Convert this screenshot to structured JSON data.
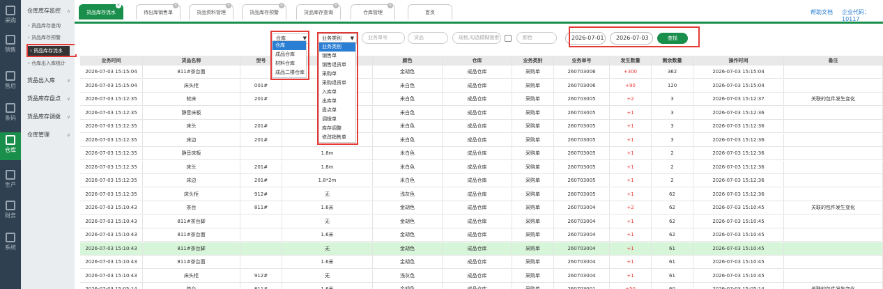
{
  "rail": [
    {
      "label": "采购",
      "icon": "cart-icon"
    },
    {
      "label": "销售",
      "icon": "grid-icon"
    },
    {
      "label": "售后",
      "icon": "building-icon"
    },
    {
      "label": "条码",
      "icon": "barcode-icon"
    },
    {
      "label": "仓库",
      "icon": "warehouse-icon"
    },
    {
      "label": "生产",
      "icon": "robot-arm-icon"
    },
    {
      "label": "财务",
      "icon": "calculator-icon"
    },
    {
      "label": "系统",
      "icon": "gear-icon"
    }
  ],
  "menu": {
    "group1": "仓库库存监控",
    "subs": [
      "› 货品库存查询",
      "› 货品库存预警",
      "› 货品库存流水",
      "› 仓库出入库统计"
    ],
    "group2": "货品出入库",
    "group3": "货品库存盘点",
    "group4": "货品库存调拨",
    "group5": "仓库管理"
  },
  "tabs": [
    "货品库存流水",
    "待出库销售单",
    "货品资料管理",
    "货品库存预警",
    "货品库存查询",
    "仓库管理",
    "首页"
  ],
  "top_links": {
    "help": "帮助文档",
    "company": "企业代码：10117"
  },
  "filters": {
    "warehouse_label": "仓库",
    "type_label": "业务类别",
    "order_no": "业务单号",
    "goods": "货品",
    "spec": "规格,勾选模糊搜索",
    "color": "颜色",
    "date_from": "2026-07-01",
    "date_to": "2026-07-03",
    "search_btn": "查找"
  },
  "warehouse_options": [
    "仓库",
    "成品仓库",
    "材料仓库",
    "成品二楼仓库"
  ],
  "type_options": [
    "业务类别",
    "销售单",
    "销售退货单",
    "采购单",
    "采购退货单",
    "入库单",
    "出库单",
    "盘点单",
    "调拨单",
    "库存调整",
    "修改销售单"
  ],
  "columns": [
    "业务时间",
    "货品名称",
    "型号",
    "规格",
    "颜色",
    "仓库",
    "业务类别",
    "业务单号",
    "发生数量",
    "剩余数量",
    "操作时间",
    "备注"
  ],
  "rows": [
    [
      "2026-07-03 15:15:04",
      "811#茶台面",
      "",
      "",
      "金胡色",
      "成品仓库",
      "采购单",
      "260703006",
      "+300",
      "362",
      "2026-07-03 15:15:04",
      ""
    ],
    [
      "2026-07-03 15:15:04",
      "床头柜",
      "001#",
      "",
      "米白色",
      "成品仓库",
      "采购单",
      "260703006",
      "+90",
      "120",
      "2026-07-03 15:15:04",
      ""
    ],
    [
      "2026-07-03 15:12:35",
      "软床",
      "201#",
      "",
      "米白色",
      "成品仓库",
      "采购单",
      "260703005",
      "+2",
      "3",
      "2026-07-03 15:12:37",
      "关联的包件发生变化"
    ],
    [
      "2026-07-03 15:12:35",
      "静音床板",
      "",
      "",
      "米白色",
      "成品仓库",
      "采购单",
      "260703005",
      "+1",
      "3",
      "2026-07-03 15:12:36",
      ""
    ],
    [
      "2026-07-03 15:12:35",
      "床头",
      "201#",
      "",
      "米白色",
      "成品仓库",
      "采购单",
      "260703005",
      "+1",
      "3",
      "2026-07-03 15:12:36",
      ""
    ],
    [
      "2026-07-03 15:12:35",
      "床边",
      "201#",
      "",
      "米白色",
      "成品仓库",
      "采购单",
      "260703005",
      "+1",
      "3",
      "2026-07-03 15:12:36",
      ""
    ],
    [
      "2026-07-03 15:12:35",
      "静音床板",
      "",
      "1.8m",
      "米白色",
      "成品仓库",
      "采购单",
      "260703005",
      "+1",
      "2",
      "2026-07-03 15:12:36",
      ""
    ],
    [
      "2026-07-03 15:12:35",
      "床头",
      "201#",
      "1.8m",
      "米白色",
      "成品仓库",
      "采购单",
      "260703005",
      "+1",
      "2",
      "2026-07-03 15:12:36",
      ""
    ],
    [
      "2026-07-03 15:12:35",
      "床边",
      "201#",
      "1.8*2m",
      "米白色",
      "成品仓库",
      "采购单",
      "260703005",
      "+1",
      "2",
      "2026-07-03 15:12:36",
      ""
    ],
    [
      "2026-07-03 15:12:35",
      "床头柜",
      "912#",
      "无",
      "浅灰色",
      "成品仓库",
      "采购单",
      "260703005",
      "+1",
      "62",
      "2026-07-03 15:12:36",
      ""
    ],
    [
      "2026-07-03 15:10:43",
      "茶台",
      "811#",
      "1.6米",
      "金胡色",
      "成品仓库",
      "采购单",
      "260703004",
      "+2",
      "62",
      "2026-07-03 15:10:45",
      "关联的包件发生变化"
    ],
    [
      "2026-07-03 15:10:43",
      "811#茶台脚",
      "",
      "无",
      "金胡色",
      "成品仓库",
      "采购单",
      "260703004",
      "+1",
      "62",
      "2026-07-03 15:10:45",
      ""
    ],
    [
      "2026-07-03 15:10:43",
      "811#茶台面",
      "",
      "1.6米",
      "金胡色",
      "成品仓库",
      "采购单",
      "260703004",
      "+1",
      "62",
      "2026-07-03 15:10:45",
      ""
    ],
    [
      "2026-07-03 15:10:43",
      "811#茶台脚",
      "",
      "无",
      "金胡色",
      "成品仓库",
      "采购单",
      "260703004",
      "+1",
      "61",
      "2026-07-03 15:10:45",
      ""
    ],
    [
      "2026-07-03 15:10:43",
      "811#茶台面",
      "",
      "1.6米",
      "金胡色",
      "成品仓库",
      "采购单",
      "260703004",
      "+1",
      "61",
      "2026-07-03 15:10:45",
      ""
    ],
    [
      "2026-07-03 15:10:43",
      "床头柜",
      "912#",
      "无",
      "浅灰色",
      "成品仓库",
      "采购单",
      "260703004",
      "+1",
      "61",
      "2026-07-03 15:10:45",
      ""
    ],
    [
      "2026-07-03 15:05:14",
      "茶台",
      "811#",
      "1.6米",
      "金胡色",
      "成品仓库",
      "采购单",
      "260703001",
      "+50",
      "60",
      "2026-07-03 15:05:14",
      "关联的包件发生变化"
    ]
  ],
  "colors": {
    "accent": "#1a8f4c",
    "highlight": "#d7f5d9",
    "rail": "#2f4050",
    "annotation": "#e53935",
    "link": "#2a7fd4"
  }
}
